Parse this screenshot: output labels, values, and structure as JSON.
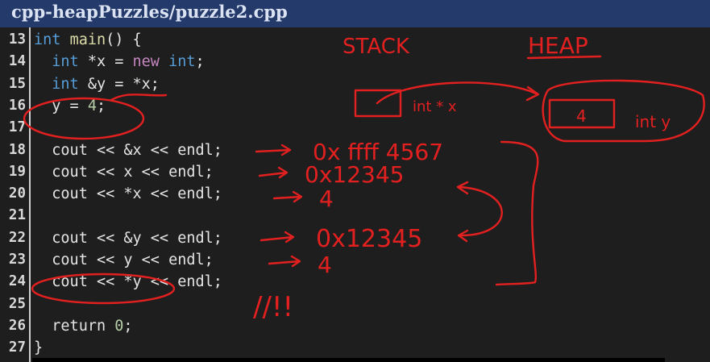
{
  "window": {
    "title": "cpp-heapPuzzles/puzzle2.cpp"
  },
  "editor": {
    "lines": [
      {
        "num": "13",
        "tokens": [
          [
            "int",
            "kw-int"
          ],
          [
            " ",
            ""
          ],
          [
            "main",
            "fn"
          ],
          [
            "() {",
            ""
          ]
        ]
      },
      {
        "num": "14",
        "tokens": [
          [
            "  ",
            ""
          ],
          [
            "int",
            "kw-int"
          ],
          [
            " *x = ",
            ""
          ],
          [
            "new",
            "kw-new"
          ],
          [
            " ",
            ""
          ],
          [
            "int",
            "kw-int"
          ],
          [
            ";",
            ""
          ]
        ]
      },
      {
        "num": "15",
        "tokens": [
          [
            "  ",
            ""
          ],
          [
            "int",
            "kw-int"
          ],
          [
            " &y = *x;",
            ""
          ]
        ]
      },
      {
        "num": "16",
        "tokens": [
          [
            "  y = ",
            ""
          ],
          [
            "4",
            "num"
          ],
          [
            ";",
            ""
          ]
        ]
      },
      {
        "num": "17",
        "tokens": []
      },
      {
        "num": "18",
        "tokens": [
          [
            "  cout << &x << endl;",
            ""
          ]
        ]
      },
      {
        "num": "19",
        "tokens": [
          [
            "  cout << x << endl;",
            ""
          ]
        ]
      },
      {
        "num": "20",
        "tokens": [
          [
            "  cout << *x << endl;",
            ""
          ]
        ]
      },
      {
        "num": "21",
        "tokens": []
      },
      {
        "num": "22",
        "tokens": [
          [
            "  cout << &y << endl;",
            ""
          ]
        ]
      },
      {
        "num": "23",
        "tokens": [
          [
            "  cout << y << endl;",
            ""
          ]
        ]
      },
      {
        "num": "24",
        "tokens": [
          [
            "  cout << *y << endl;",
            ""
          ]
        ]
      },
      {
        "num": "25",
        "tokens": []
      },
      {
        "num": "26",
        "tokens": [
          [
            "  return ",
            ""
          ],
          [
            "0",
            "num"
          ],
          [
            ";",
            ""
          ]
        ]
      },
      {
        "num": "27",
        "tokens": [
          [
            "}",
            ""
          ]
        ]
      }
    ]
  },
  "annotations": {
    "stack_label": "STACK",
    "heap_label": "HEAP",
    "stack_box_label": "int * x",
    "heap_box_value": "4",
    "heap_box_label": "int y",
    "out_addr_x": "0x ffff 4567",
    "out_x": "0x12345",
    "out_deref_x": "4",
    "out_addr_y": "0x12345",
    "out_y": "4",
    "error_mark": "//!!",
    "color": "#e32020"
  }
}
